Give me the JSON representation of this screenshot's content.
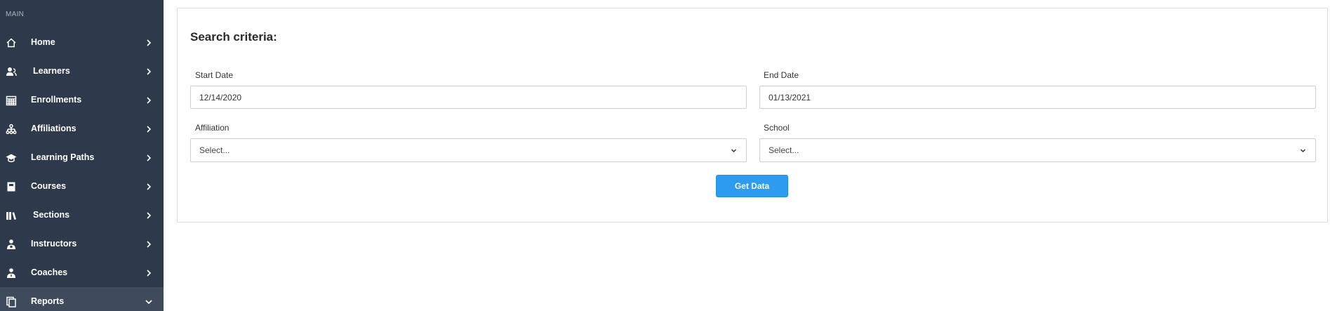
{
  "sidebar": {
    "section_label": "MAIN",
    "items": [
      {
        "label": "Home",
        "icon": "home-icon"
      },
      {
        "label": "Learners",
        "icon": "user-group-icon"
      },
      {
        "label": "Enrollments",
        "icon": "calendar-grid-icon"
      },
      {
        "label": "Affiliations",
        "icon": "org-chart-icon"
      },
      {
        "label": "Learning Paths",
        "icon": "graduation-cap-icon"
      },
      {
        "label": "Courses",
        "icon": "book-icon"
      },
      {
        "label": "Sections",
        "icon": "books-icon"
      },
      {
        "label": "Instructors",
        "icon": "instructor-icon"
      },
      {
        "label": "Coaches",
        "icon": "coach-icon"
      },
      {
        "label": "Reports",
        "icon": "reports-icon",
        "active": true
      }
    ]
  },
  "search": {
    "title": "Search criteria:",
    "start_date_label": "Start Date",
    "start_date_value": "12/14/2020",
    "end_date_label": "End Date",
    "end_date_value": "01/13/2021",
    "affiliation_label": "Affiliation",
    "affiliation_value": "Select...",
    "school_label": "School",
    "school_value": "Select...",
    "submit_label": "Get Data"
  },
  "colors": {
    "sidebar_bg": "#2e3a4b",
    "sidebar_active": "#3f4b5d",
    "primary_button": "#2d9cf0"
  }
}
